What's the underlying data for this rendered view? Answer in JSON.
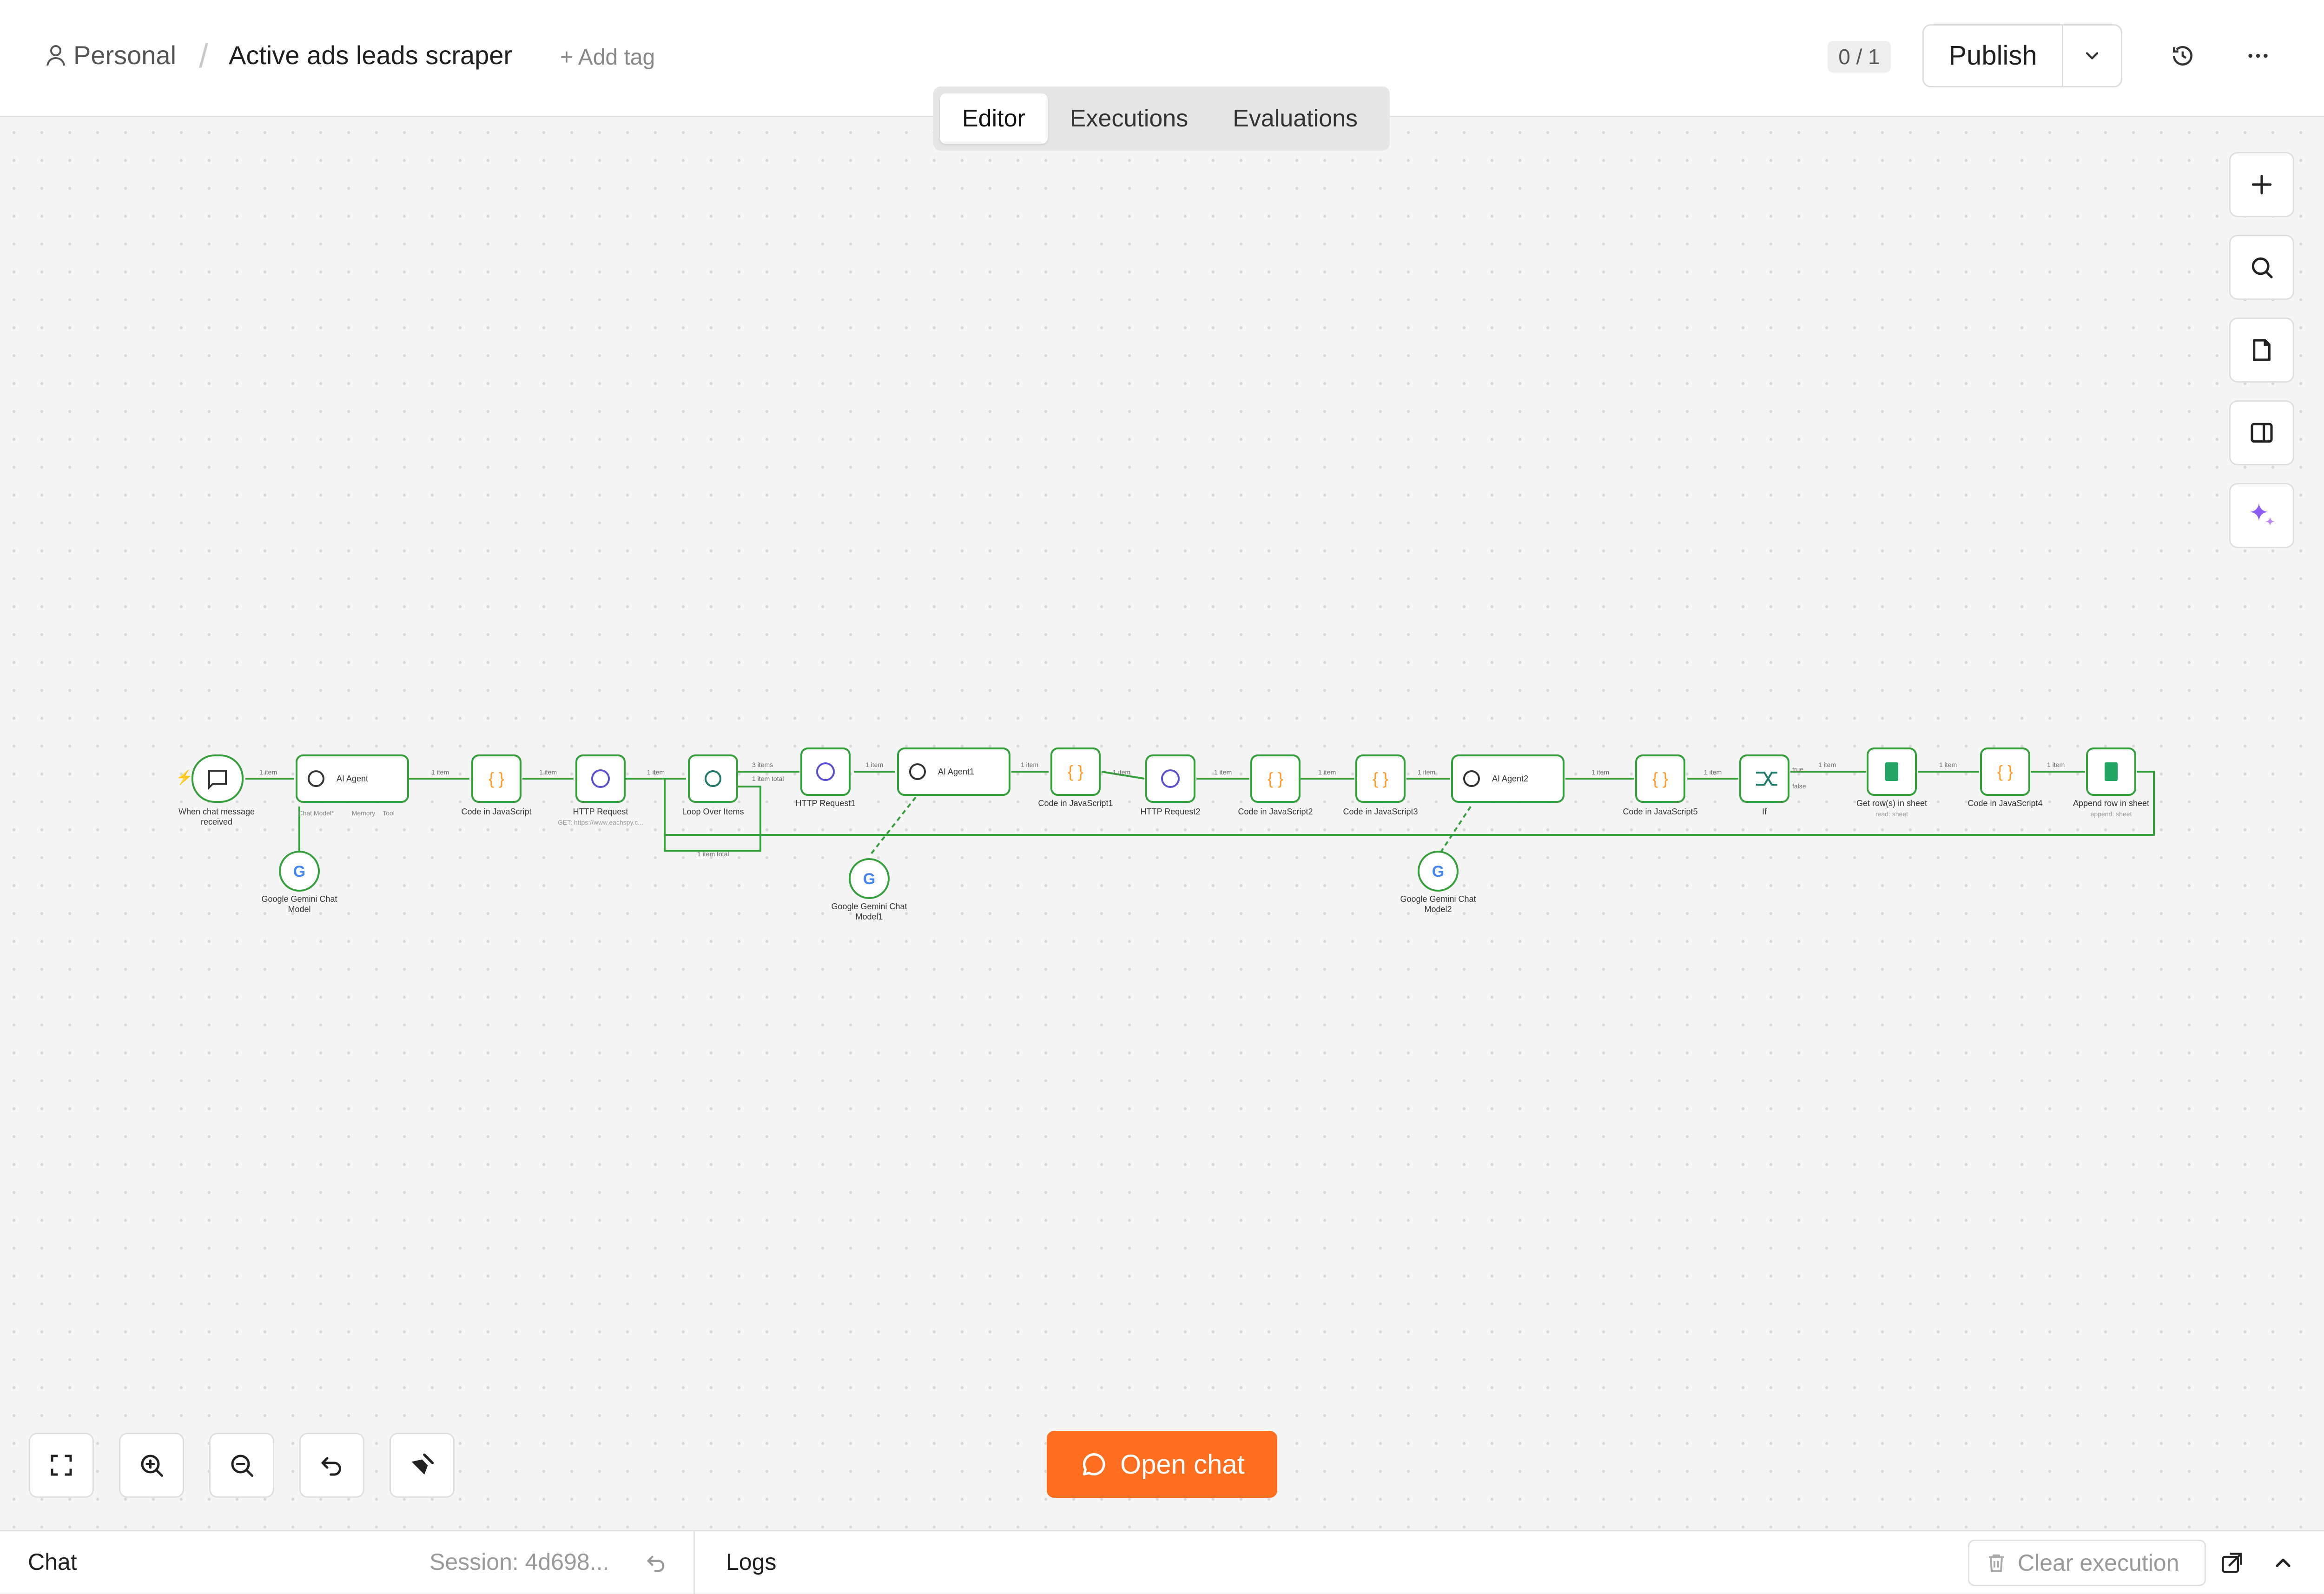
{
  "header": {
    "project": "Personal",
    "workflow_title": "Active ads leads scraper",
    "add_tag": "+ Add tag",
    "counter": "0 / 1",
    "publish_label": "Publish"
  },
  "tabs": [
    {
      "label": "Editor",
      "active": true
    },
    {
      "label": "Executions",
      "active": false
    },
    {
      "label": "Evaluations",
      "active": false
    }
  ],
  "right_toolbar": [
    "plus-icon",
    "search-icon",
    "sticky-note-icon",
    "panel-icon",
    "sparkle-icon"
  ],
  "nodes": [
    {
      "label": "When chat message",
      "label2": "received",
      "icon": "chat-icon"
    },
    {
      "label": "AI Agent",
      "icon": "robot-icon"
    },
    {
      "label": "Code in JavaScript",
      "icon": "code-icon"
    },
    {
      "label": "HTTP Request",
      "sub": "GET: https://www.eachspy.c...",
      "icon": "globe-icon"
    },
    {
      "label": "Loop Over Items",
      "icon": "loop-icon"
    },
    {
      "label": "HTTP Request1",
      "icon": "globe-icon"
    },
    {
      "label": "AI Agent1",
      "icon": "robot-icon"
    },
    {
      "label": "Code in JavaScript1",
      "icon": "code-icon"
    },
    {
      "label": "HTTP Request2",
      "icon": "globe-icon"
    },
    {
      "label": "Code in JavaScript2",
      "icon": "code-icon"
    },
    {
      "label": "Code in JavaScript3",
      "icon": "code-icon"
    },
    {
      "label": "AI Agent2",
      "icon": "robot-icon"
    },
    {
      "label": "Code in JavaScript5",
      "icon": "code-icon"
    },
    {
      "label": "If",
      "icon": "if-icon"
    },
    {
      "label": "Get row(s) in sheet",
      "sub": "read: sheet",
      "icon": "sheet-icon"
    },
    {
      "label": "Code in JavaScript4",
      "icon": "code-icon"
    },
    {
      "label": "Append row in sheet",
      "sub": "append: sheet",
      "icon": "sheet-icon"
    }
  ],
  "model_nodes": [
    {
      "label": "Google Gemini Chat",
      "label2": "Model"
    },
    {
      "label": "Google Gemini Chat",
      "label2": "Model1"
    },
    {
      "label": "Google Gemini Chat",
      "label2": "Model2"
    }
  ],
  "port_labels": {
    "chat_model": "Chat Model*",
    "memory": "Memory",
    "tool": "Tool",
    "model": "Model",
    "one_item": "1 item",
    "three_items": "3 items",
    "done": "1 item total",
    "loop": "1 item total",
    "true": "true",
    "false": "false"
  },
  "buttons": {
    "open_chat": "Open chat"
  },
  "bottom": {
    "chat": "Chat",
    "session": "Session: 4d698...",
    "logs": "Logs",
    "clear_execution": "Clear execution"
  },
  "colors": {
    "accent": "#ff6d1f",
    "success": "#35a03b",
    "code": "#ff9b26",
    "globe": "#5a4fcf",
    "sheet": "#23a566"
  }
}
